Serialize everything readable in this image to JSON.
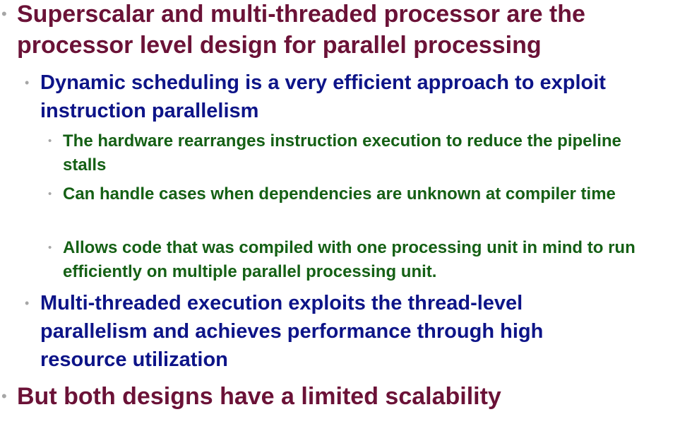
{
  "slide": {
    "bullet_glyph": "•",
    "colors": {
      "level1": "#6b1237",
      "level2": "#0d1488",
      "level3": "#156015",
      "bullet": "#a6a6a6",
      "background": "#ffffff"
    },
    "items": [
      {
        "level": 1,
        "text": "Superscalar and multi-threaded processor are the processor level design for parallel processing"
      },
      {
        "level": 2,
        "text": "Dynamic scheduling is a very efficient approach to exploit instruction parallelism"
      },
      {
        "level": 3,
        "text": "The hardware rearranges instruction execution to reduce the pipeline stalls"
      },
      {
        "level": 3,
        "text": "Can handle cases when dependencies are unknown at compiler time"
      },
      {
        "level": 3,
        "text": "Allows code that was compiled with one processing unit in mind to run efficiently on multiple parallel processing unit."
      },
      {
        "level": 2,
        "text": "Multi-threaded execution exploits the thread-level parallelism and achieves performance through high resource utilization"
      },
      {
        "level": 1,
        "text": "But both designs have a limited scalability"
      }
    ]
  }
}
